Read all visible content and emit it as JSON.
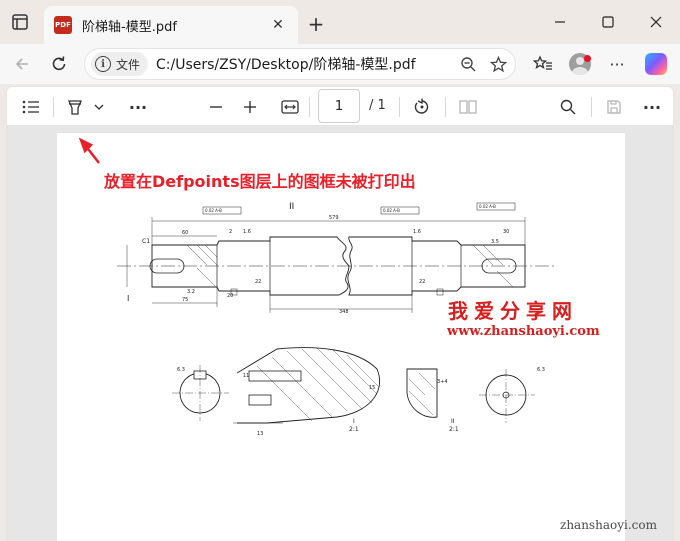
{
  "browser": {
    "tab_title": "阶梯轴-模型.pdf",
    "tab_icon": "PDF",
    "site_chip_label": "文件",
    "url": "C:/Users/ZSY/Desktop/阶梯轴-模型.pdf"
  },
  "pdf_toolbar": {
    "page_current": "1",
    "page_total": "/ 1"
  },
  "document": {
    "note": "放置在Defpoints图层上的图框未被打印出",
    "watermark_cn": "我爱分享网",
    "watermark_url": "www.zhanshaoyi.com",
    "watermark_corner": "zhanshaoyi.com",
    "drawing_labels": {
      "detail_ii": "II",
      "detail_i": "I",
      "length_total": "579",
      "length_mid": "348",
      "dim_60": "60",
      "dim_75": "75",
      "dim_16a": "1.6",
      "dim_16b": "1.6",
      "dim_c1": "C1",
      "dim_32": "3.2",
      "dim_20": "20",
      "dim_22a": "22",
      "dim_22b": "22",
      "dim_35": "3.5",
      "dim_30": "30",
      "dim_2": "2",
      "dim_63a": "6.3",
      "dim_63b": "6.3",
      "dim_15": "15",
      "dim_11": "11",
      "dim_13": "13",
      "dim_3plus4": "3+4",
      "scale_i": "I\n2:1",
      "scale_ii": "II\n2:1",
      "tol_a": "0.02 A-B",
      "tol_b": "0.02 A-B",
      "tol_c": "0.02 A-B"
    }
  },
  "colors": {
    "chrome_bg": "#efe9e6",
    "accent_red": "#e8202a",
    "watermark_red": "#d62020",
    "pdf_badge": "#c42b1c"
  }
}
